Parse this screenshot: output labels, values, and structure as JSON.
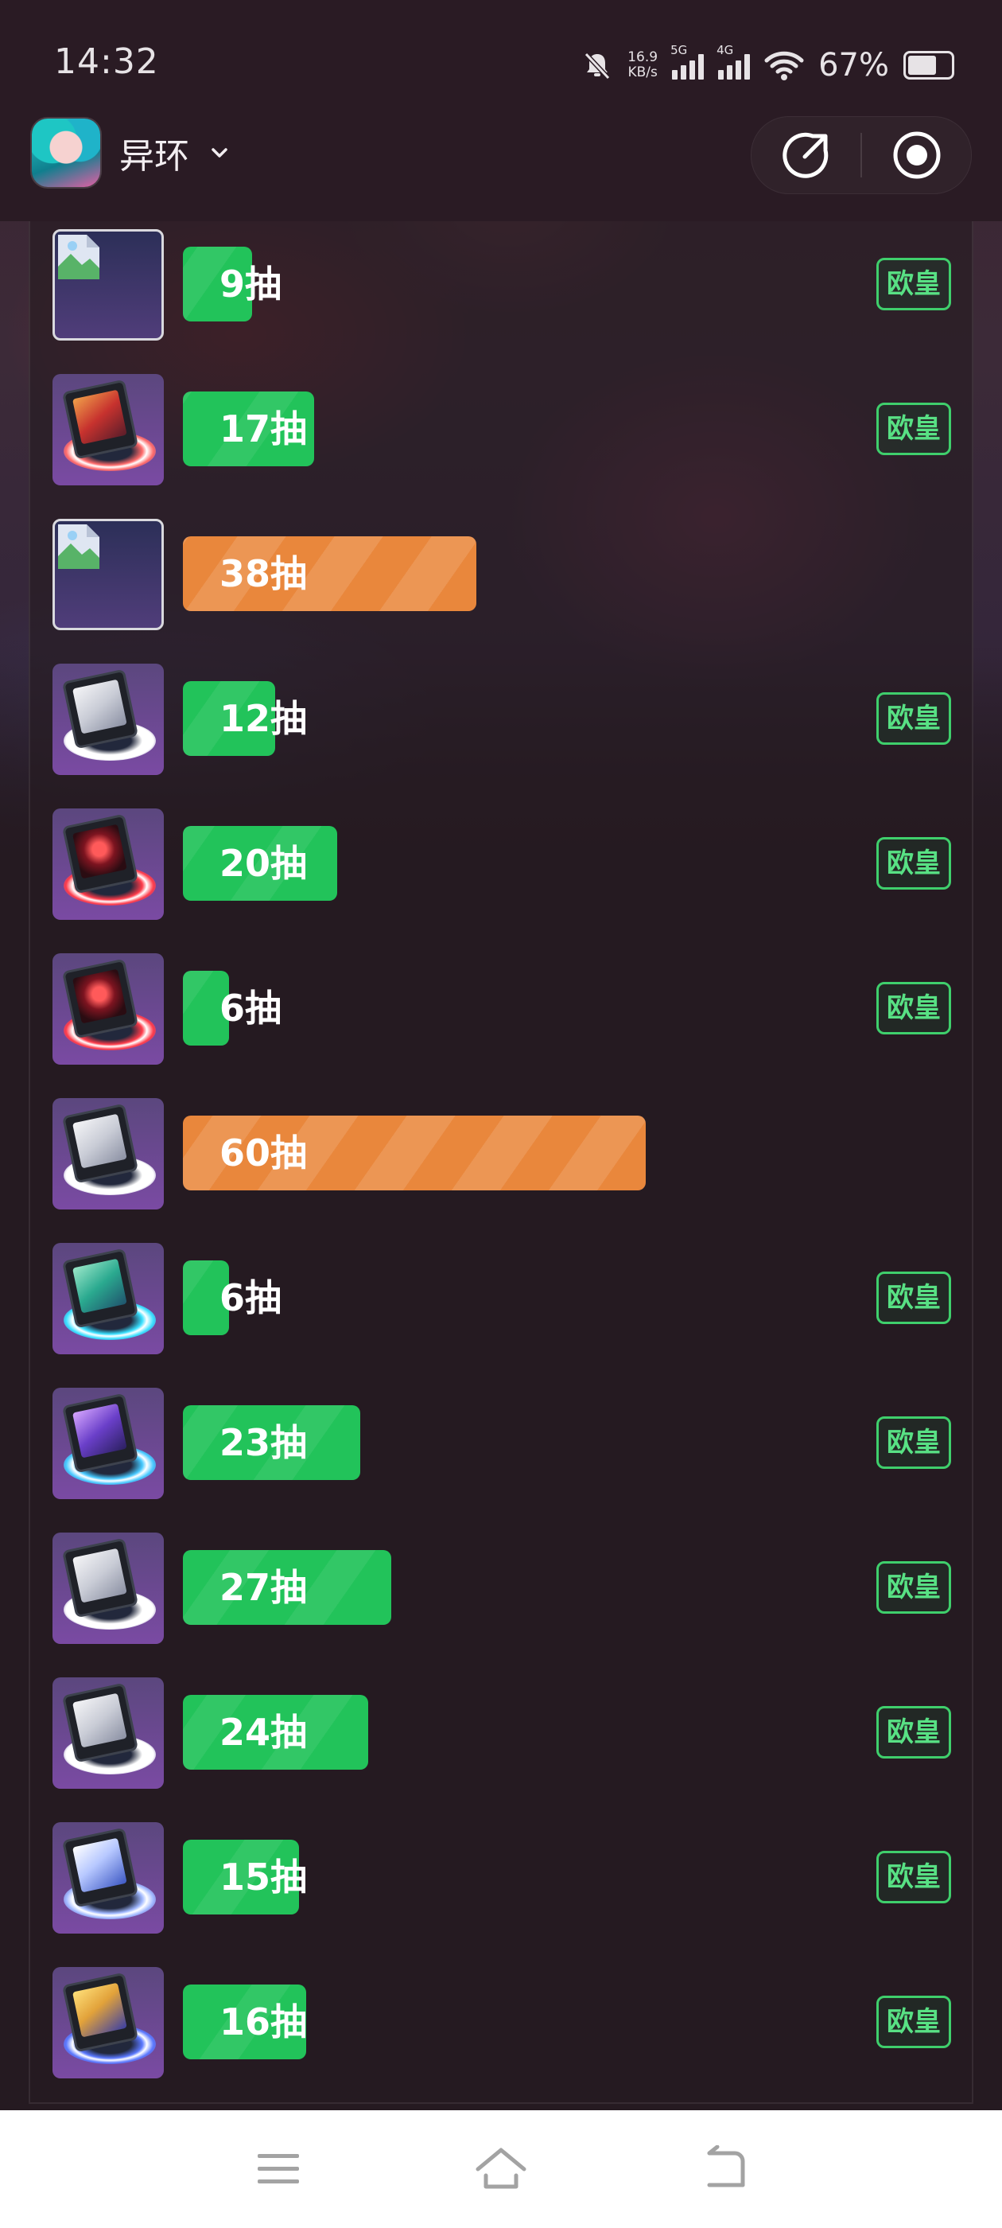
{
  "status_bar": {
    "time": "14:32",
    "net_speed_value": "16.9",
    "net_speed_unit": "KB/s",
    "sim1_label": "5G",
    "sim2_label": "4G",
    "battery_percent": "67%",
    "battery_level": 0.67
  },
  "header": {
    "game_name": "异环"
  },
  "pulls": [
    {
      "label": "9抽",
      "value": 9,
      "color": "green",
      "badge": "欧皇",
      "thumb": "placeholder"
    },
    {
      "label": "17抽",
      "value": 17,
      "color": "green",
      "badge": "欧皇",
      "thumb": "red-cone"
    },
    {
      "label": "38抽",
      "value": 38,
      "color": "orange",
      "badge": "",
      "thumb": "placeholder"
    },
    {
      "label": "12抽",
      "value": 12,
      "color": "green",
      "badge": "欧皇",
      "thumb": "white-cone"
    },
    {
      "label": "20抽",
      "value": 20,
      "color": "green",
      "badge": "欧皇",
      "thumb": "crimson-cone"
    },
    {
      "label": "6抽",
      "value": 6,
      "color": "green",
      "badge": "欧皇",
      "thumb": "crimson-cone"
    },
    {
      "label": "60抽",
      "value": 60,
      "color": "orange",
      "badge": "",
      "thumb": "white-cone"
    },
    {
      "label": "6抽",
      "value": 6,
      "color": "green",
      "badge": "欧皇",
      "thumb": "teal-cone"
    },
    {
      "label": "23抽",
      "value": 23,
      "color": "green",
      "badge": "欧皇",
      "thumb": "violet-cone"
    },
    {
      "label": "27抽",
      "value": 27,
      "color": "green",
      "badge": "欧皇",
      "thumb": "white-cone"
    },
    {
      "label": "24抽",
      "value": 24,
      "color": "green",
      "badge": "欧皇",
      "thumb": "white-cone"
    },
    {
      "label": "15抽",
      "value": 15,
      "color": "green",
      "badge": "欧皇",
      "thumb": "blue-cone"
    },
    {
      "label": "16抽",
      "value": 16,
      "color": "green",
      "badge": "欧皇",
      "thumb": "gold-cone"
    }
  ],
  "colors": {
    "lucky_green": "#22c35a",
    "warning_orange": "#e9873c",
    "badge_green": "#3fcf6c",
    "background": "#251a21"
  },
  "icons": {
    "share": "share-icon",
    "record": "record-icon",
    "chevron": "chevron-down-icon",
    "menu": "menu-icon",
    "home": "home-icon",
    "back": "back-icon"
  }
}
